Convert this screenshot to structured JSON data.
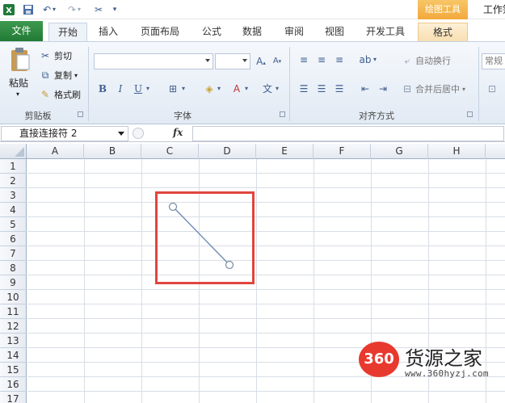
{
  "titlebar": {
    "context_tool_label": "绘图工具",
    "window_title": "工作簿"
  },
  "tabs": [
    {
      "label": "文件",
      "kind": "file"
    },
    {
      "label": "开始",
      "kind": "active"
    },
    {
      "label": "插入",
      "kind": "normal"
    },
    {
      "label": "页面布局",
      "kind": "normal"
    },
    {
      "label": "公式",
      "kind": "normal"
    },
    {
      "label": "数据",
      "kind": "normal"
    },
    {
      "label": "审阅",
      "kind": "normal"
    },
    {
      "label": "视图",
      "kind": "normal"
    },
    {
      "label": "开发工具",
      "kind": "normal"
    },
    {
      "label": "格式",
      "kind": "context"
    }
  ],
  "ribbon": {
    "clipboard": {
      "paste_label": "粘贴",
      "cut_label": "剪切",
      "copy_label": "复制",
      "format_painter_label": "格式刷",
      "group_label": "剪贴板"
    },
    "font": {
      "font_name": "",
      "font_size": "",
      "bold": "B",
      "italic": "I",
      "underline": "U",
      "group_label": "字体"
    },
    "alignment": {
      "wrap_text_label": "自动换行",
      "merge_center_label": "合并后居中",
      "group_label": "对齐方式"
    },
    "number": {
      "format_label": "常规"
    }
  },
  "formula_bar": {
    "name_box": "直接连接符 2",
    "fx_label": "fx",
    "formula": ""
  },
  "columns": [
    "A",
    "B",
    "C",
    "D",
    "E",
    "F",
    "G",
    "H"
  ],
  "rows": [
    "1",
    "2",
    "3",
    "4",
    "5",
    "6",
    "7",
    "8",
    "9",
    "10",
    "11",
    "12",
    "13",
    "14",
    "15",
    "16",
    "17"
  ],
  "drawing": {
    "shape_type": "straight-connector",
    "line_color": "#6f8db5",
    "highlight_color": "#e0463e"
  },
  "watermark": {
    "logo_text": "360",
    "site_name": "货源之家",
    "url": "www.360hyzj.com"
  }
}
